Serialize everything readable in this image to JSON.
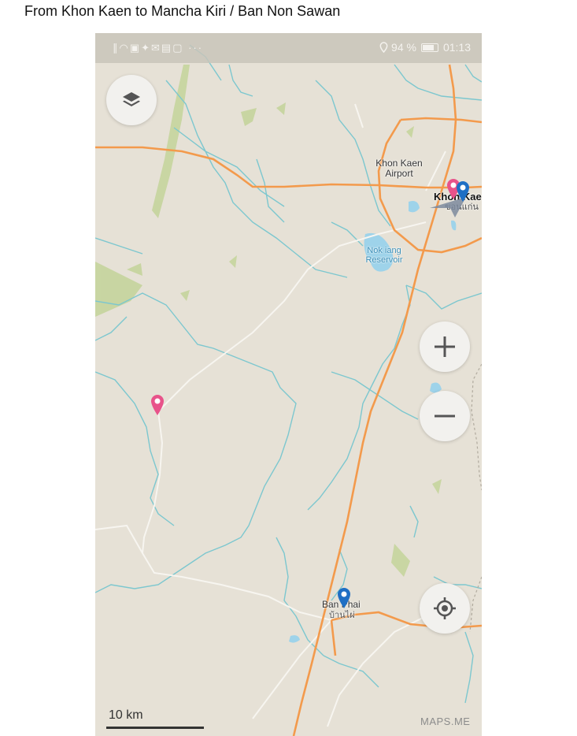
{
  "page": {
    "title": "From Khon Kaen to Mancha Kiri / Ban Non Sawan"
  },
  "status_bar": {
    "left_icons": "∥◠▣✦✉▤▢ ···",
    "battery_percent": "94 %",
    "time": "01:13"
  },
  "map": {
    "labels": {
      "airport": "Khon Kaen Airport",
      "khon_kaen": "Khon Kae",
      "khon_kaen_thai": "ขอนแก่น",
      "reservoir": "Nok iang Reservoir",
      "ban_phai": "Ban Phai",
      "ban_phai_thai": "บ้านไผ่"
    },
    "scale": "10 km",
    "attribution": "MAPS.ME"
  },
  "controls": {
    "layers": "layers-icon",
    "zoom_in": "plus-icon",
    "zoom_out": "minus-icon",
    "locate": "locate-icon"
  },
  "colors": {
    "land": "#e6e1d6",
    "road_major": "#f39a4c",
    "river": "#7cc7cf",
    "water": "#9ed3ea",
    "forest": "#c3d39a",
    "pin_pink": "#e8538a",
    "pin_blue": "#1f6fc4"
  }
}
